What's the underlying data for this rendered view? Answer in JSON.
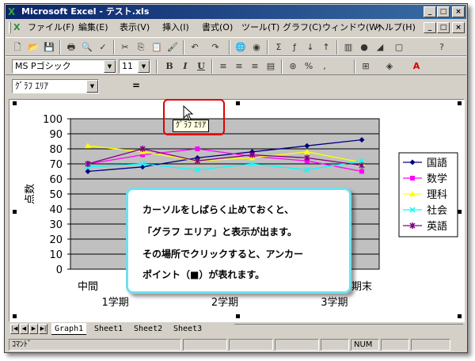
{
  "window": {
    "title": "Microsoft Excel - テスト.xls",
    "app_icon": "excel-icon",
    "controls": [
      "minimize-icon",
      "maximize-icon",
      "close-icon"
    ]
  },
  "menubar": {
    "items": [
      "ファイル(F)",
      "編集(E)",
      "表示(V)",
      "挿入(I)",
      "書式(O)",
      "ツール(T)",
      "グラフ(C)",
      "ウィンドウ(W)",
      "ヘルプ(H)"
    ]
  },
  "formatting": {
    "font_name": "MS Pゴシック",
    "font_size": "11",
    "bold": "B",
    "italic": "I",
    "underline": "U",
    "percent": "%"
  },
  "formula_bar": {
    "name_box": "ｸﾞﾗﾌ ｴﾘｱ",
    "equals": "="
  },
  "tooltip": "ｸﾞﾗﾌ ｴﾘｱ",
  "chart_data": {
    "type": "line",
    "categories": [
      "中間|1学期",
      "期末|1学期",
      "中間|2学期",
      "期末|2学期",
      "中間|3学期",
      "期末|3学期"
    ],
    "x_tick_top": [
      "中間",
      "",
      "",
      "",
      "",
      "期末"
    ],
    "x_tick_bottom": [
      "1学期",
      "2学期",
      "3学期"
    ],
    "ylabel": "点数",
    "ylim": [
      0,
      100
    ],
    "yticks": [
      0,
      10,
      20,
      30,
      40,
      50,
      60,
      70,
      80,
      90,
      100
    ],
    "plot_background": "#c0c0c0",
    "legend_position": "right",
    "series": [
      {
        "name": "国語",
        "color": "#000080",
        "marker": "diamond",
        "values": [
          65,
          68,
          74,
          78,
          82,
          86
        ]
      },
      {
        "name": "数学",
        "color": "#ff00ff",
        "marker": "square",
        "values": [
          70,
          76,
          80,
          75,
          72,
          65
        ]
      },
      {
        "name": "理科",
        "color": "#ffff00",
        "marker": "triangle",
        "values": [
          82,
          78,
          72,
          74,
          78,
          71
        ]
      },
      {
        "name": "社会",
        "color": "#00ffff",
        "marker": "x",
        "values": [
          68,
          70,
          66,
          70,
          66,
          72
        ]
      },
      {
        "name": "英語",
        "color": "#800080",
        "marker": "star",
        "values": [
          70,
          80,
          72,
          76,
          74,
          69
        ]
      }
    ]
  },
  "callout": {
    "lines": [
      "カーソルをしばらく止めておくと、",
      "「グラフ エリア」と表示が出ます。",
      "その場所でクリックすると、アンカー",
      "ポイント（■）が表れます。"
    ]
  },
  "sheet_tabs": [
    "Graph1",
    "Sheet1",
    "Sheet2",
    "Sheet3"
  ],
  "status": {
    "mode": "ｺﾏﾝﾄﾞ",
    "num": "NUM"
  }
}
